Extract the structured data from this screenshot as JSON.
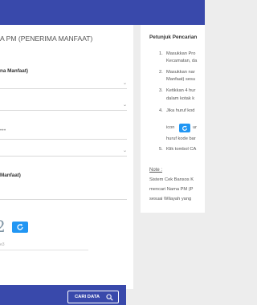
{
  "form": {
    "title": "A PM (PENERIMA MANFAAT)",
    "field1_label": "na Manfaat)",
    "masked_value": "•••",
    "field2_label": "Manfaat)",
    "captcha_char": "2",
    "captcha_hint": "e3",
    "search_button": "CARI DATA"
  },
  "info": {
    "title": "Petunjuk Pencarian",
    "steps": [
      {
        "num": "1.",
        "line1": "Masukkan Pro",
        "line2": "Kecamatan, da"
      },
      {
        "num": "2.",
        "line1": "Masukkan nar",
        "line2": "Manfaat) sesu"
      },
      {
        "num": "3.",
        "line1": "Ketikkan 4 hur",
        "line2": "dalam kotak k"
      },
      {
        "num": "4.",
        "line1": "Jika huruf kod",
        "line2_pre": "icon",
        "line2_post": "ur",
        "line3": "huruf kode bar"
      },
      {
        "num": "5.",
        "line1": "Klik tombol CA"
      }
    ],
    "note_title": "Note :",
    "note_lines": [
      "Sistem Cek Bansos K",
      "mencari Nama PM (P",
      "sesuai Wilayah yang"
    ]
  },
  "colors": {
    "primary": "#3949ab",
    "refresh": "#2196f3",
    "background": "#ededed"
  }
}
